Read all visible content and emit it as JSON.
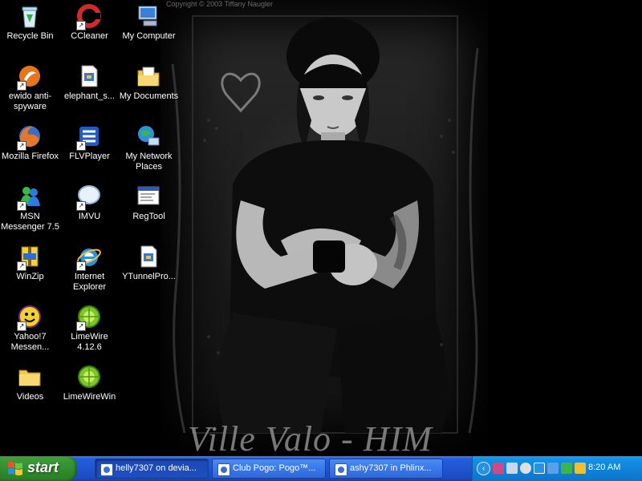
{
  "wallpaper": {
    "copyright": "Copyright © 2003 Tiffany Naugler",
    "signature": "Ville Valo - HIM"
  },
  "desktop_icons": [
    {
      "label": "Recycle Bin",
      "icon": "recycle-bin-icon",
      "shortcut": false
    },
    {
      "label": "CCleaner",
      "icon": "ccleaner-icon",
      "shortcut": true
    },
    {
      "label": "My Computer",
      "icon": "my-computer-icon",
      "shortcut": false
    },
    {
      "label": "ewido anti-spyware",
      "icon": "ewido-icon",
      "shortcut": true
    },
    {
      "label": "elephant_s...",
      "icon": "document-icon",
      "shortcut": false
    },
    {
      "label": "My Documents",
      "icon": "my-documents-icon",
      "shortcut": false
    },
    {
      "label": "Mozilla Firefox",
      "icon": "firefox-icon",
      "shortcut": true
    },
    {
      "label": "FLVPlayer",
      "icon": "flvplayer-icon",
      "shortcut": true
    },
    {
      "label": "My Network Places",
      "icon": "network-places-icon",
      "shortcut": false
    },
    {
      "label": "MSN Messenger 7.5",
      "icon": "msn-messenger-icon",
      "shortcut": true
    },
    {
      "label": "IMVU",
      "icon": "imvu-icon",
      "shortcut": true
    },
    {
      "label": "RegTool",
      "icon": "regtool-icon",
      "shortcut": false
    },
    {
      "label": "WinZip",
      "icon": "winzip-icon",
      "shortcut": true
    },
    {
      "label": "Internet Explorer",
      "icon": "internet-explorer-icon",
      "shortcut": true
    },
    {
      "label": "YTunnelPro...",
      "icon": "document-icon",
      "shortcut": false
    },
    {
      "label": "Yahoo!7 Messen...",
      "icon": "yahoo-messenger-icon",
      "shortcut": true
    },
    {
      "label": "LimeWire 4.12.6",
      "icon": "limewire-icon",
      "shortcut": true
    },
    {
      "label": "Videos",
      "icon": "folder-icon",
      "shortcut": false
    },
    {
      "label": "LimeWireWin",
      "icon": "limewire-icon",
      "shortcut": false
    }
  ],
  "taskbar": {
    "start_label": "start",
    "tasks": [
      {
        "label": "helly7307 on devia...",
        "active": true
      },
      {
        "label": "Club Pogo: Pogo™...",
        "active": false
      },
      {
        "label": "ashy7307 in Phlinx...",
        "active": false
      }
    ],
    "tray_icons": [
      "network-icon",
      "speaker-icon",
      "msn-tray-icon",
      "update-icon",
      "security-icon",
      "messenger-tray-icon",
      "display-icon"
    ],
    "clock": "8:20 AM"
  },
  "colors": {
    "taskbar_blue": "#245edb",
    "start_green": "#3c9a38",
    "tray_blue": "#0f80d8"
  }
}
